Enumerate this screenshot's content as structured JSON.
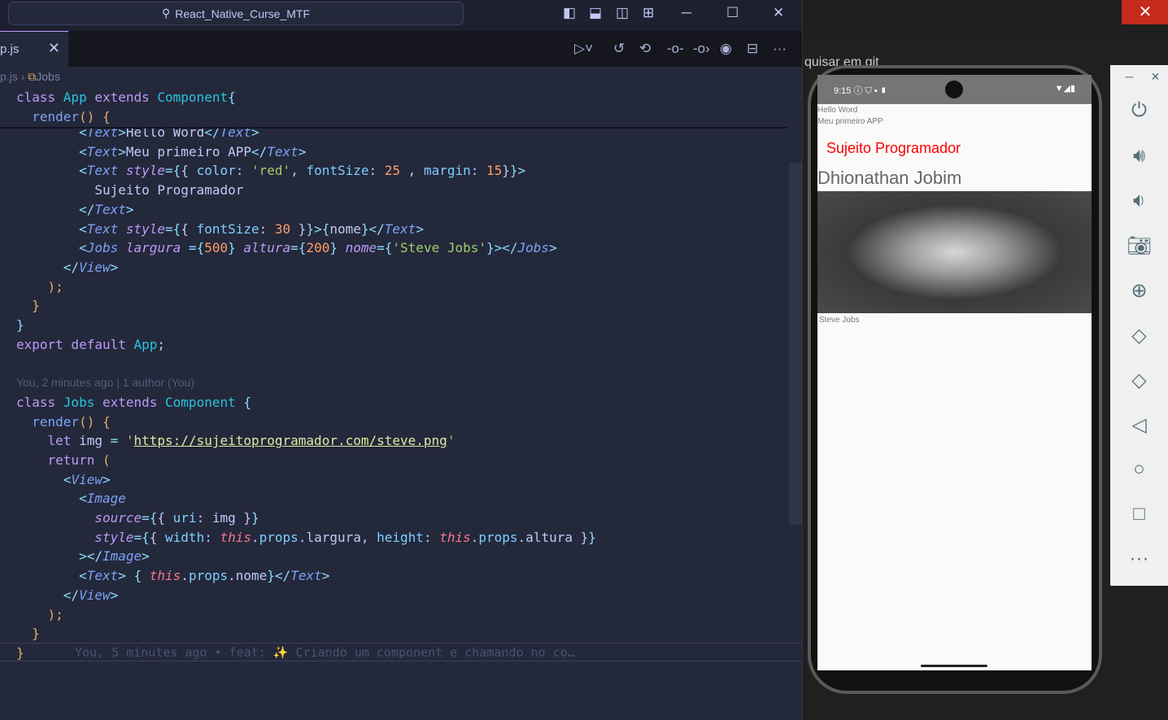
{
  "window": {
    "search_title": "React_Native_Curse_MTF"
  },
  "tab": {
    "label": "p.js",
    "close": "✕"
  },
  "breadcrumb": {
    "file": "p.js",
    "sep": "›",
    "symbol": "Jobs"
  },
  "codelens": "You, 2 minutes ago | 1 author (You)",
  "blame": "You, 5 minutes ago • feat: ✨ Criando um component e chamando no co…",
  "sticky": [
    [
      [
        "k",
        "class "
      ],
      [
        "c",
        "App "
      ],
      [
        "k",
        "extends "
      ],
      [
        "c",
        "Component"
      ],
      [
        "p",
        "{"
      ]
    ],
    [
      [
        "",
        "  "
      ],
      [
        "f",
        "render"
      ],
      [
        "b",
        "() {"
      ]
    ]
  ],
  "code": [
    [
      [
        "",
        "        "
      ],
      [
        "p",
        "<"
      ],
      [
        "t",
        "Text"
      ],
      [
        "p",
        ">"
      ],
      [
        "",
        "Hello Word"
      ],
      [
        "p",
        "</"
      ],
      [
        "t",
        "Text"
      ],
      [
        "p",
        ">"
      ]
    ],
    [
      [
        "",
        "        "
      ],
      [
        "p",
        "<"
      ],
      [
        "t",
        "Text"
      ],
      [
        "p",
        ">"
      ],
      [
        "",
        "Meu primeiro APP"
      ],
      [
        "p",
        "</"
      ],
      [
        "t",
        "Text"
      ],
      [
        "p",
        ">"
      ]
    ],
    [
      [
        "",
        "        "
      ],
      [
        "p",
        "<"
      ],
      [
        "t",
        "Text "
      ],
      [
        "a",
        "style"
      ],
      [
        "p",
        "={"
      ],
      [
        "",
        "{ "
      ],
      [
        "pr",
        "color"
      ],
      [
        "",
        ": "
      ],
      [
        "s",
        "'red'"
      ],
      [
        "",
        ", "
      ],
      [
        "pr",
        "fontSize"
      ],
      [
        "",
        ": "
      ],
      [
        "n",
        "25"
      ],
      [
        "",
        " , "
      ],
      [
        "pr",
        "margin"
      ],
      [
        "",
        ": "
      ],
      [
        "n",
        "15"
      ],
      [
        "",
        "}"
      ],
      [
        "p",
        "}>"
      ]
    ],
    [
      [
        "",
        "          Sujeito Programador"
      ]
    ],
    [
      [
        "",
        "        "
      ],
      [
        "p",
        "</"
      ],
      [
        "t",
        "Text"
      ],
      [
        "p",
        ">"
      ]
    ],
    [
      [
        "",
        "        "
      ],
      [
        "p",
        "<"
      ],
      [
        "t",
        "Text "
      ],
      [
        "a",
        "style"
      ],
      [
        "p",
        "={"
      ],
      [
        "",
        "{ "
      ],
      [
        "pr",
        "fontSize"
      ],
      [
        "",
        ": "
      ],
      [
        "n",
        "30"
      ],
      [
        "",
        " }"
      ],
      [
        "p",
        "}>{"
      ],
      [
        "",
        "nome"
      ],
      [
        "p",
        "}</"
      ],
      [
        "t",
        "Text"
      ],
      [
        "p",
        ">"
      ]
    ],
    [
      [
        "",
        "        "
      ],
      [
        "p",
        "<"
      ],
      [
        "t",
        "Jobs "
      ],
      [
        "a",
        "largura "
      ],
      [
        "p",
        "={"
      ],
      [
        "n",
        "500"
      ],
      [
        "p",
        "} "
      ],
      [
        "a",
        "altura"
      ],
      [
        "p",
        "={"
      ],
      [
        "n",
        "200"
      ],
      [
        "p",
        "} "
      ],
      [
        "a",
        "nome"
      ],
      [
        "p",
        "={"
      ],
      [
        "s",
        "'Steve Jobs'"
      ],
      [
        "p",
        "}></"
      ],
      [
        "t",
        "Jobs"
      ],
      [
        "p",
        ">"
      ]
    ],
    [
      [
        "",
        "      "
      ],
      [
        "p",
        "</"
      ],
      [
        "t",
        "View"
      ],
      [
        "p",
        ">"
      ]
    ],
    [
      [
        "",
        "    "
      ],
      [
        "b",
        ");"
      ]
    ],
    [
      [
        "",
        "  "
      ],
      [
        "b",
        "}"
      ]
    ],
    [
      [
        "p",
        "}"
      ]
    ],
    [
      [
        "k",
        "export default "
      ],
      [
        "c",
        "App"
      ],
      [
        "",
        ";"
      ]
    ],
    [
      [
        "",
        ""
      ]
    ],
    [
      [
        "",
        ""
      ]
    ],
    [
      [
        "k",
        "class "
      ],
      [
        "c",
        "Jobs "
      ],
      [
        "k",
        "extends "
      ],
      [
        "c",
        "Component "
      ],
      [
        "p",
        "{"
      ]
    ],
    [
      [
        "",
        "  "
      ],
      [
        "f",
        "render"
      ],
      [
        "b",
        "() {"
      ]
    ],
    [
      [
        "",
        "    "
      ],
      [
        "k",
        "let "
      ],
      [
        "",
        "img "
      ],
      [
        "p",
        "= "
      ],
      [
        "s",
        "'"
      ],
      [
        "u",
        "https://sujeitoprogramador.com/steve.png"
      ],
      [
        "s",
        "'"
      ]
    ],
    [
      [
        "",
        "    "
      ],
      [
        "k",
        "return "
      ],
      [
        "b",
        "("
      ]
    ],
    [
      [
        "",
        "      "
      ],
      [
        "p",
        "<"
      ],
      [
        "t",
        "View"
      ],
      [
        "p",
        ">"
      ]
    ],
    [
      [
        "",
        "        "
      ],
      [
        "p",
        "<"
      ],
      [
        "t",
        "Image"
      ]
    ],
    [
      [
        "",
        "          "
      ],
      [
        "a",
        "source"
      ],
      [
        "p",
        "={"
      ],
      [
        "",
        "{ "
      ],
      [
        "pr",
        "uri"
      ],
      [
        "",
        ": img }"
      ],
      [
        "p",
        "}"
      ]
    ],
    [
      [
        "",
        "          "
      ],
      [
        "a",
        "style"
      ],
      [
        "p",
        "={"
      ],
      [
        "",
        "{ "
      ],
      [
        "pr",
        "width"
      ],
      [
        "",
        ": "
      ],
      [
        "ts",
        "this"
      ],
      [
        "",
        "."
      ],
      [
        "pr",
        "props"
      ],
      [
        "",
        ".largura, "
      ],
      [
        "pr",
        "height"
      ],
      [
        "",
        ": "
      ],
      [
        "ts",
        "this"
      ],
      [
        "",
        "."
      ],
      [
        "pr",
        "props"
      ],
      [
        "",
        ".altura }"
      ],
      [
        "p",
        "}"
      ]
    ],
    [
      [
        "",
        "        "
      ],
      [
        "p",
        "></"
      ],
      [
        "t",
        "Image"
      ],
      [
        "p",
        ">"
      ]
    ],
    [
      [
        "",
        "        "
      ],
      [
        "p",
        "<"
      ],
      [
        "t",
        "Text"
      ],
      [
        "p",
        "> { "
      ],
      [
        "ts",
        "this"
      ],
      [
        "",
        "."
      ],
      [
        "pr",
        "props"
      ],
      [
        "",
        ".nome"
      ],
      [
        "p",
        "}</"
      ],
      [
        "t",
        "Text"
      ],
      [
        "p",
        ">"
      ]
    ],
    [
      [
        "",
        "      "
      ],
      [
        "p",
        "</"
      ],
      [
        "t",
        "View"
      ],
      [
        "p",
        ">"
      ]
    ],
    [
      [
        "",
        "    "
      ],
      [
        "b",
        ");"
      ]
    ],
    [
      [
        "",
        "  "
      ],
      [
        "b",
        "}"
      ]
    ],
    [
      [
        "b",
        "}"
      ]
    ]
  ],
  "emulator": {
    "time": "9:15",
    "lines": [
      "Hello Word",
      "Meu primeiro APP"
    ],
    "red_text": "Sujeito Programador",
    "name_text": "Dhionathan Jobim",
    "caption": "Steve Jobs",
    "red": "#ff0000"
  },
  "background_text": "quisar em git"
}
